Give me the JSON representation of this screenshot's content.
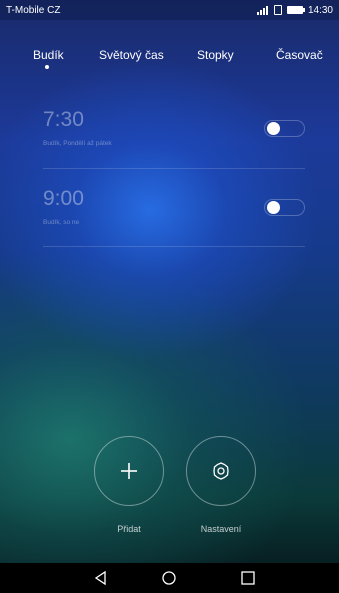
{
  "status_bar": {
    "carrier": "T-Mobile CZ",
    "time": "14:30",
    "icons": [
      "signal-icon",
      "sim-icon",
      "battery-icon"
    ]
  },
  "tabs": [
    {
      "label": "Budík",
      "selected": true
    },
    {
      "label": "Světový čas",
      "selected": false
    },
    {
      "label": "Stopky",
      "selected": false
    },
    {
      "label": "Časovač",
      "selected": false
    }
  ],
  "alarms": [
    {
      "time": "7:30",
      "description": "Budík, Pondělí až pátek",
      "enabled": false
    },
    {
      "time": "9:00",
      "description": "Budík, so ne",
      "enabled": false
    }
  ],
  "actions": {
    "add_label": "Přidat",
    "add_icon": "plus-icon",
    "settings_label": "Nastavení",
    "settings_icon": "gear-icon"
  },
  "nav_bar": {
    "icons": [
      "back-icon",
      "home-icon",
      "recent-apps-icon"
    ]
  },
  "colors": {
    "text": "#ffffff",
    "nav_bar": "#000000"
  }
}
